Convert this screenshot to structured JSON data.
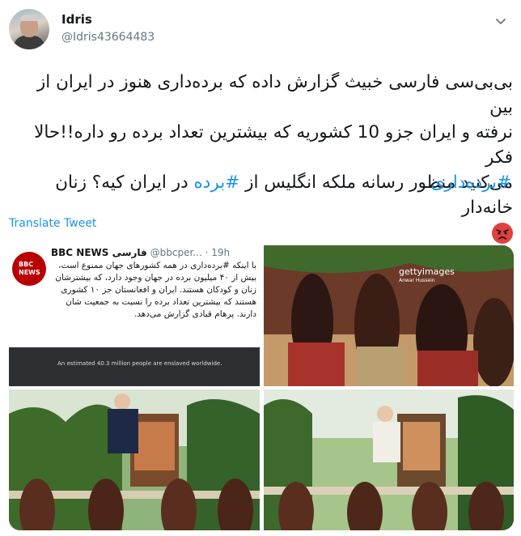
{
  "user": {
    "name": "Idris",
    "handle": "@Idris43664483"
  },
  "tweet": {
    "line1_prefix": "بی‌بی‌سی فارسی خبیث گزارش داده که برده‌داری هنوز در ایران از بین",
    "line2": "نرفته و ایران جزو 10 کشوریه که بیشترین تعداد برده رو داره!!حالا فکر",
    "line3_pre": "می‌کنید منظور رسانه ملکه انگلیس از",
    "line3_hashtag": "#برده",
    "line3_post": "در ایران کیه؟ زنان خانه‌دار",
    "emoji": "pouting-face",
    "hashtag2": "#برده‌داری"
  },
  "translate_label": "Translate Tweet",
  "media": {
    "bbc": {
      "logo_line1": "BBC",
      "logo_line2": "NEWS",
      "title": "BBC NEWS فارسی",
      "handle": "@bbcper...",
      "time": "· 19h",
      "body": "با اینکه #برده‌داری در همه کشورهای جهان ممنوع است، بیش از ۴۰ میلیون برده در جهان وجود دارد، که بیشترشان زنان و کودکان هستند. ایران و افغانستان جز ۱۰ کشوری هستند که بیشترین تعداد برده را نسبت به جمعیت شان دارند. پرهام قبادی گزارش می‌دهد.",
      "band_text": "An estimated 40.3 million people are enslaved worldwide."
    },
    "getty": {
      "label": "gettyimages",
      "credit": "Anwar Hussein"
    }
  },
  "colors": {
    "link": "#1b95e0",
    "bbc_red": "#b80000",
    "text": "#14171a",
    "muted": "#657786"
  }
}
